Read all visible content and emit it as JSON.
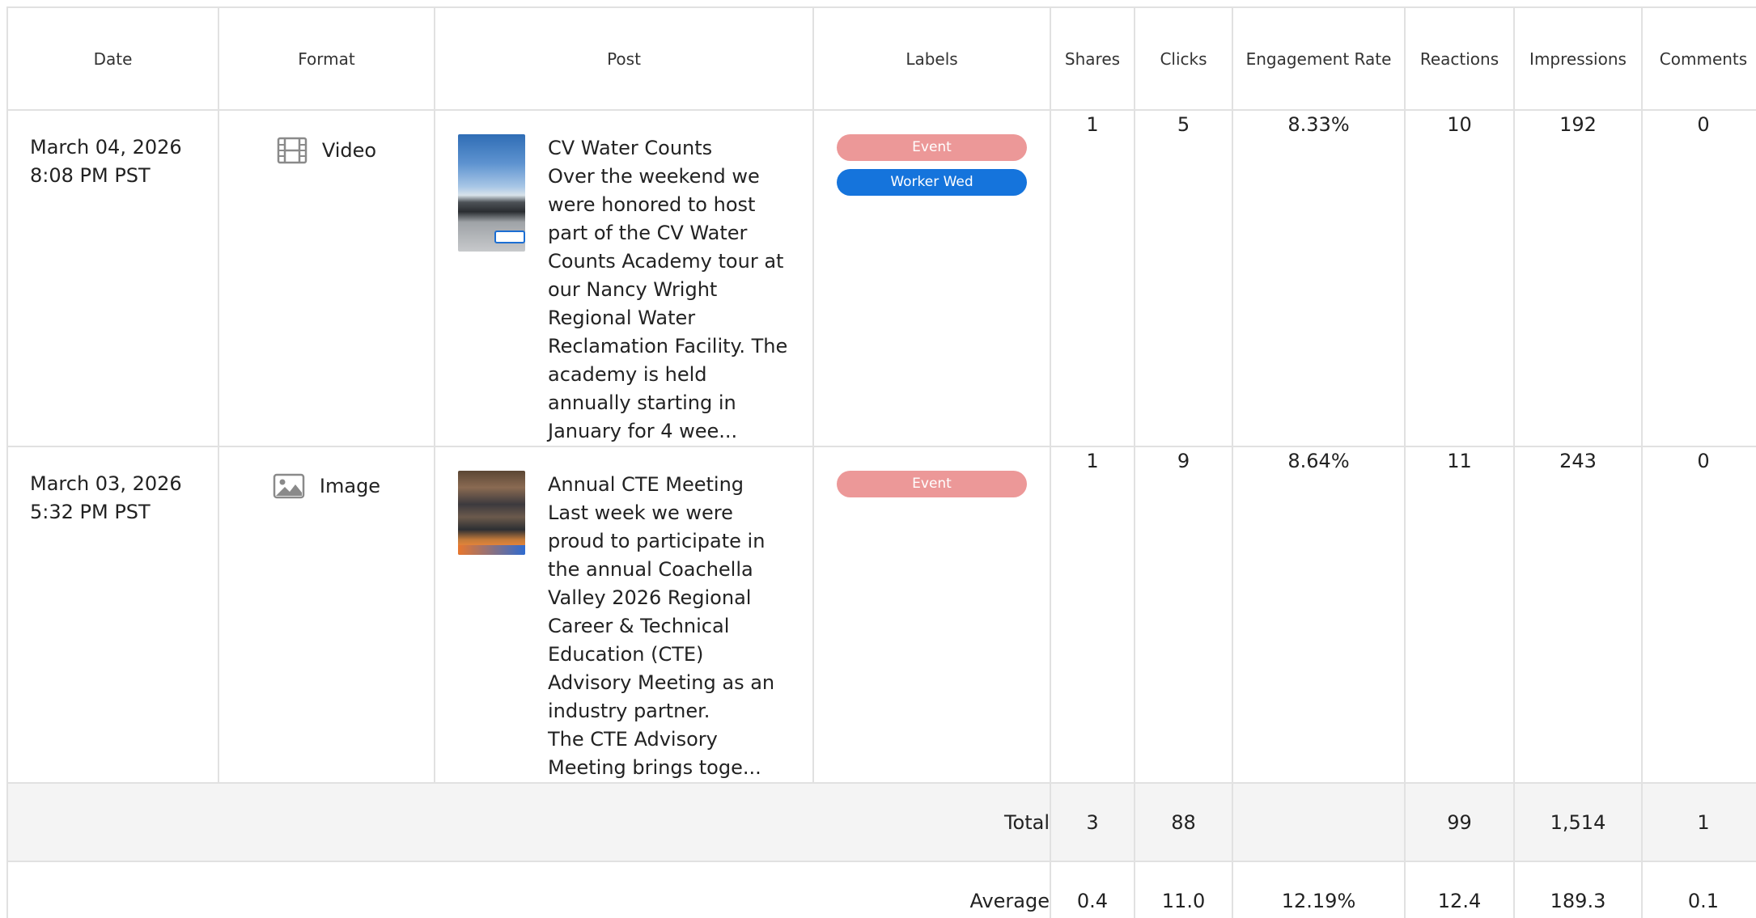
{
  "columns": {
    "date": "Date",
    "format": "Format",
    "post": "Post",
    "labels": "Labels",
    "shares": "Shares",
    "clicks": "Clicks",
    "engagement_rate": "Engagement Rate",
    "reactions": "Reactions",
    "impressions": "Impressions",
    "comments": "Comments"
  },
  "rows": [
    {
      "date": "March 04, 2026",
      "time": "8:08 PM PST",
      "format": "Video",
      "format_icon": "film-icon",
      "post_text": "CV Water Counts\nOver the weekend we were honored to host part of the CV Water Counts Academy tour at our Nancy Wright Regional Water Reclamation Facility. The academy is held annually starting in January for 4 wee...",
      "labels": [
        {
          "text": "Event",
          "color": "#ec9898"
        },
        {
          "text": "Worker Wed",
          "color": "#1574dc"
        }
      ],
      "shares": "1",
      "clicks": "5",
      "engagement_rate": "8.33%",
      "reactions": "10",
      "impressions": "192",
      "comments": "0"
    },
    {
      "date": "March 03, 2026",
      "time": "5:32 PM PST",
      "format": "Image",
      "format_icon": "image-icon",
      "post_text": "Annual CTE Meeting\nLast week we were proud to participate in the annual Coachella Valley 2026 Regional Career & Technical Education (CTE) Advisory Meeting as an industry partner.\nThe CTE Advisory Meeting brings toge...",
      "labels": [
        {
          "text": "Event",
          "color": "#ec9898"
        }
      ],
      "shares": "1",
      "clicks": "9",
      "engagement_rate": "8.64%",
      "reactions": "11",
      "impressions": "243",
      "comments": "0"
    }
  ],
  "total": {
    "label": "Total",
    "shares": "3",
    "clicks": "88",
    "engagement_rate": "",
    "reactions": "99",
    "impressions": "1,514",
    "comments": "1"
  },
  "average": {
    "label": "Average",
    "shares": "0.4",
    "clicks": "11.0",
    "engagement_rate": "12.19%",
    "reactions": "12.4",
    "impressions": "189.3",
    "comments": "0.1"
  },
  "colors": {
    "label_event": "#ec9898",
    "label_worker_wed": "#1574dc",
    "total_row_bg": "#f4f4f4",
    "grid_border": "#e1e1e1"
  }
}
